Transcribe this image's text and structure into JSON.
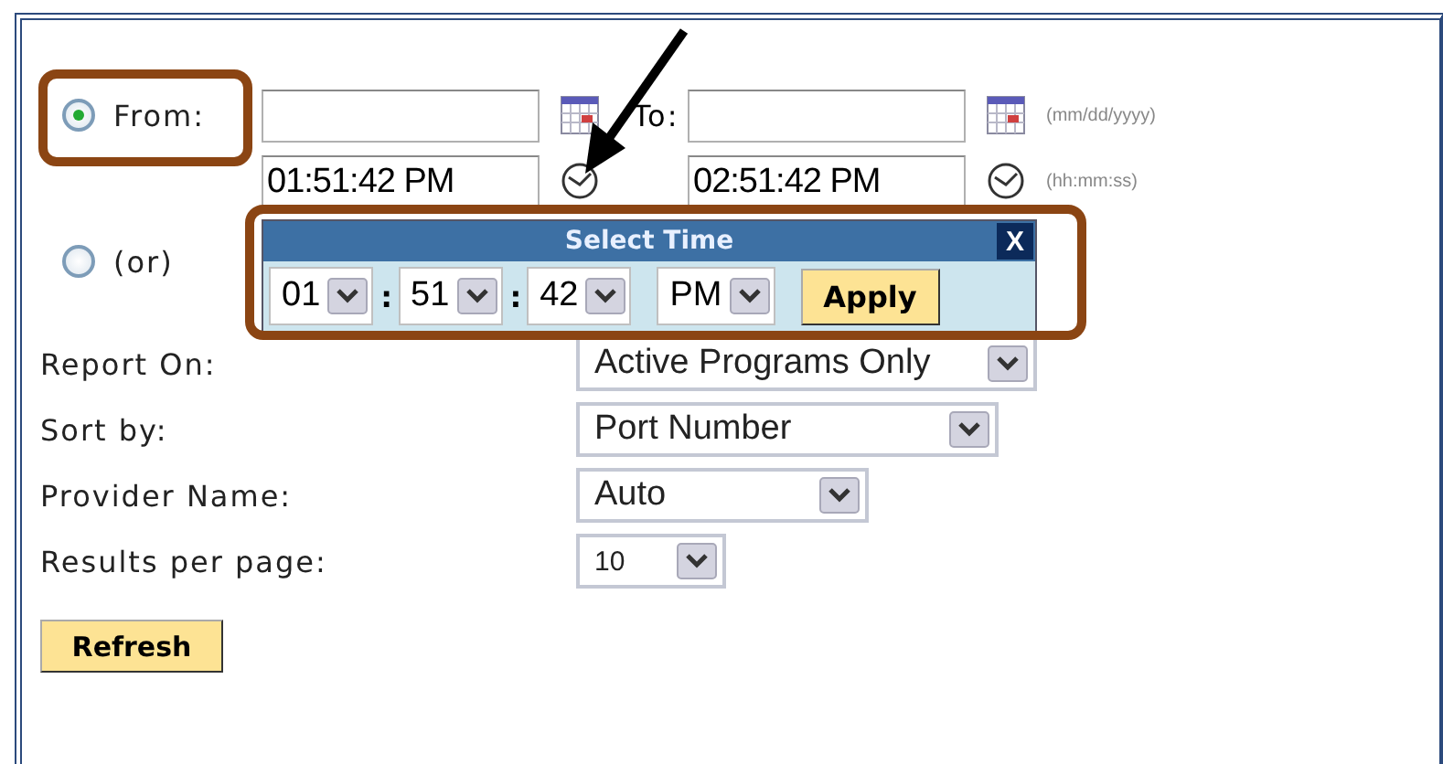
{
  "modes": [
    {
      "label": "From:",
      "selected": true
    },
    {
      "label": "(or)",
      "selected": false
    }
  ],
  "from": {
    "time": "01:51:42 PM"
  },
  "to": {
    "label": "To:",
    "time": "02:51:42 PM"
  },
  "hints": {
    "date": "(mm/dd/yyyy)",
    "time": "(hh:mm:ss)"
  },
  "time_popup": {
    "title": "Select Time",
    "close": "X",
    "fields": [
      {
        "value": "01"
      },
      {
        "separator": ":",
        "value": "51"
      },
      {
        "separator": ":",
        "value": "42"
      },
      {
        "value": "PM"
      }
    ],
    "apply": "Apply"
  },
  "settings": [
    {
      "label": "Report On:",
      "value": "Active Programs Only"
    },
    {
      "label": "Sort by:",
      "value": "Port Number"
    },
    {
      "label": "Provider Name:",
      "value": "Auto"
    },
    {
      "label": "Results per page:",
      "value": "10"
    }
  ],
  "refresh": "Refresh"
}
